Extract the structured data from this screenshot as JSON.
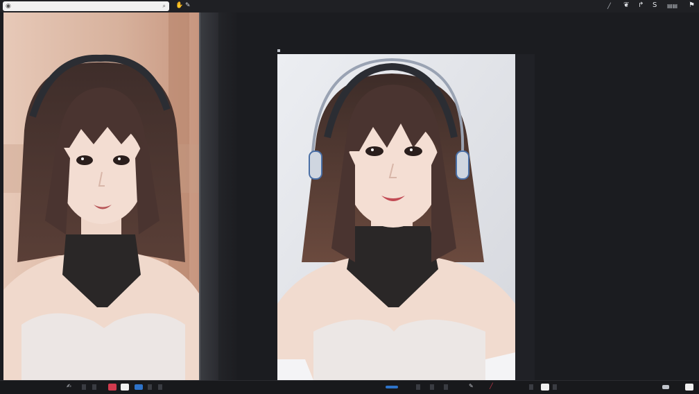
{
  "topbar": {
    "search_placeholder": "",
    "title": "",
    "icons": [
      "search-icon",
      "brush-icon",
      "pen-icon",
      "wand-icon",
      "curve-icon",
      "layers-icon",
      "flag-icon"
    ]
  },
  "canvas": {
    "doc_label": ""
  },
  "bottombar": {
    "left_label": "",
    "mid_label": "",
    "page_label": ""
  },
  "colors": {
    "accent_blue": "#2e73c9",
    "red": "#d23b4e",
    "white": "#f0f0f0",
    "bg": "#1b1c20"
  }
}
